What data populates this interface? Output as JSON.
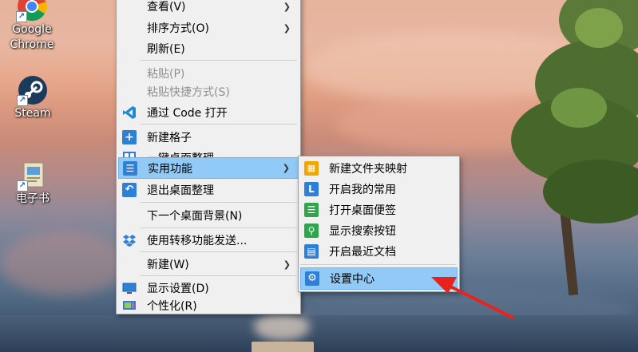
{
  "desktop": {
    "icons": [
      {
        "label": "Google Chrome",
        "icon": "chrome-icon"
      },
      {
        "label": "Steam",
        "icon": "steam-icon"
      },
      {
        "label": "电子书",
        "icon": "ebook-icon"
      }
    ]
  },
  "context_menu": {
    "items": [
      {
        "label": "查看(V)",
        "has_submenu": true
      },
      {
        "label": "排序方式(O)",
        "has_submenu": true
      },
      {
        "label": "刷新(E)"
      },
      {
        "label": "粘贴(P)",
        "disabled": true
      },
      {
        "label": "粘贴快捷方式(S)",
        "disabled": true
      },
      {
        "label": "通过 Code 打开",
        "icon": "vscode-icon"
      },
      {
        "label": "新建格子",
        "icon": "add-box-icon"
      },
      {
        "label": "一键桌面整理",
        "icon": "layout-icon"
      },
      {
        "label": "实用功能",
        "icon": "list-icon",
        "has_submenu": true,
        "highlighted": true
      },
      {
        "label": "退出桌面整理",
        "icon": "exit-icon"
      },
      {
        "label": "下一个桌面背景(N)"
      },
      {
        "label": "使用转移功能发送...",
        "icon": "dropbox-icon"
      },
      {
        "label": "新建(W)",
        "has_submenu": true
      },
      {
        "label": "显示设置(D)",
        "icon": "display-icon"
      },
      {
        "label": "个性化(R)",
        "icon": "personalize-icon"
      }
    ]
  },
  "submenu": {
    "items": [
      {
        "label": "新建文件夹映射",
        "icon": "folder-map-icon",
        "color": "#f2a400"
      },
      {
        "label": "开启我的常用",
        "icon": "clock-icon",
        "color": "#2e7fd6"
      },
      {
        "label": "打开桌面便签",
        "icon": "note-icon",
        "color": "#2ea64b"
      },
      {
        "label": "显示搜索按钮",
        "icon": "search-icon",
        "color": "#2ea64b"
      },
      {
        "label": "开启最近文档",
        "icon": "document-icon",
        "color": "#2e7fd6"
      },
      {
        "label": "设置中心",
        "icon": "gear-icon",
        "color": "#2e7fd6",
        "highlighted": true
      }
    ]
  },
  "colors": {
    "highlight": "#91c9f7",
    "annotation_arrow": "#e8231b"
  }
}
